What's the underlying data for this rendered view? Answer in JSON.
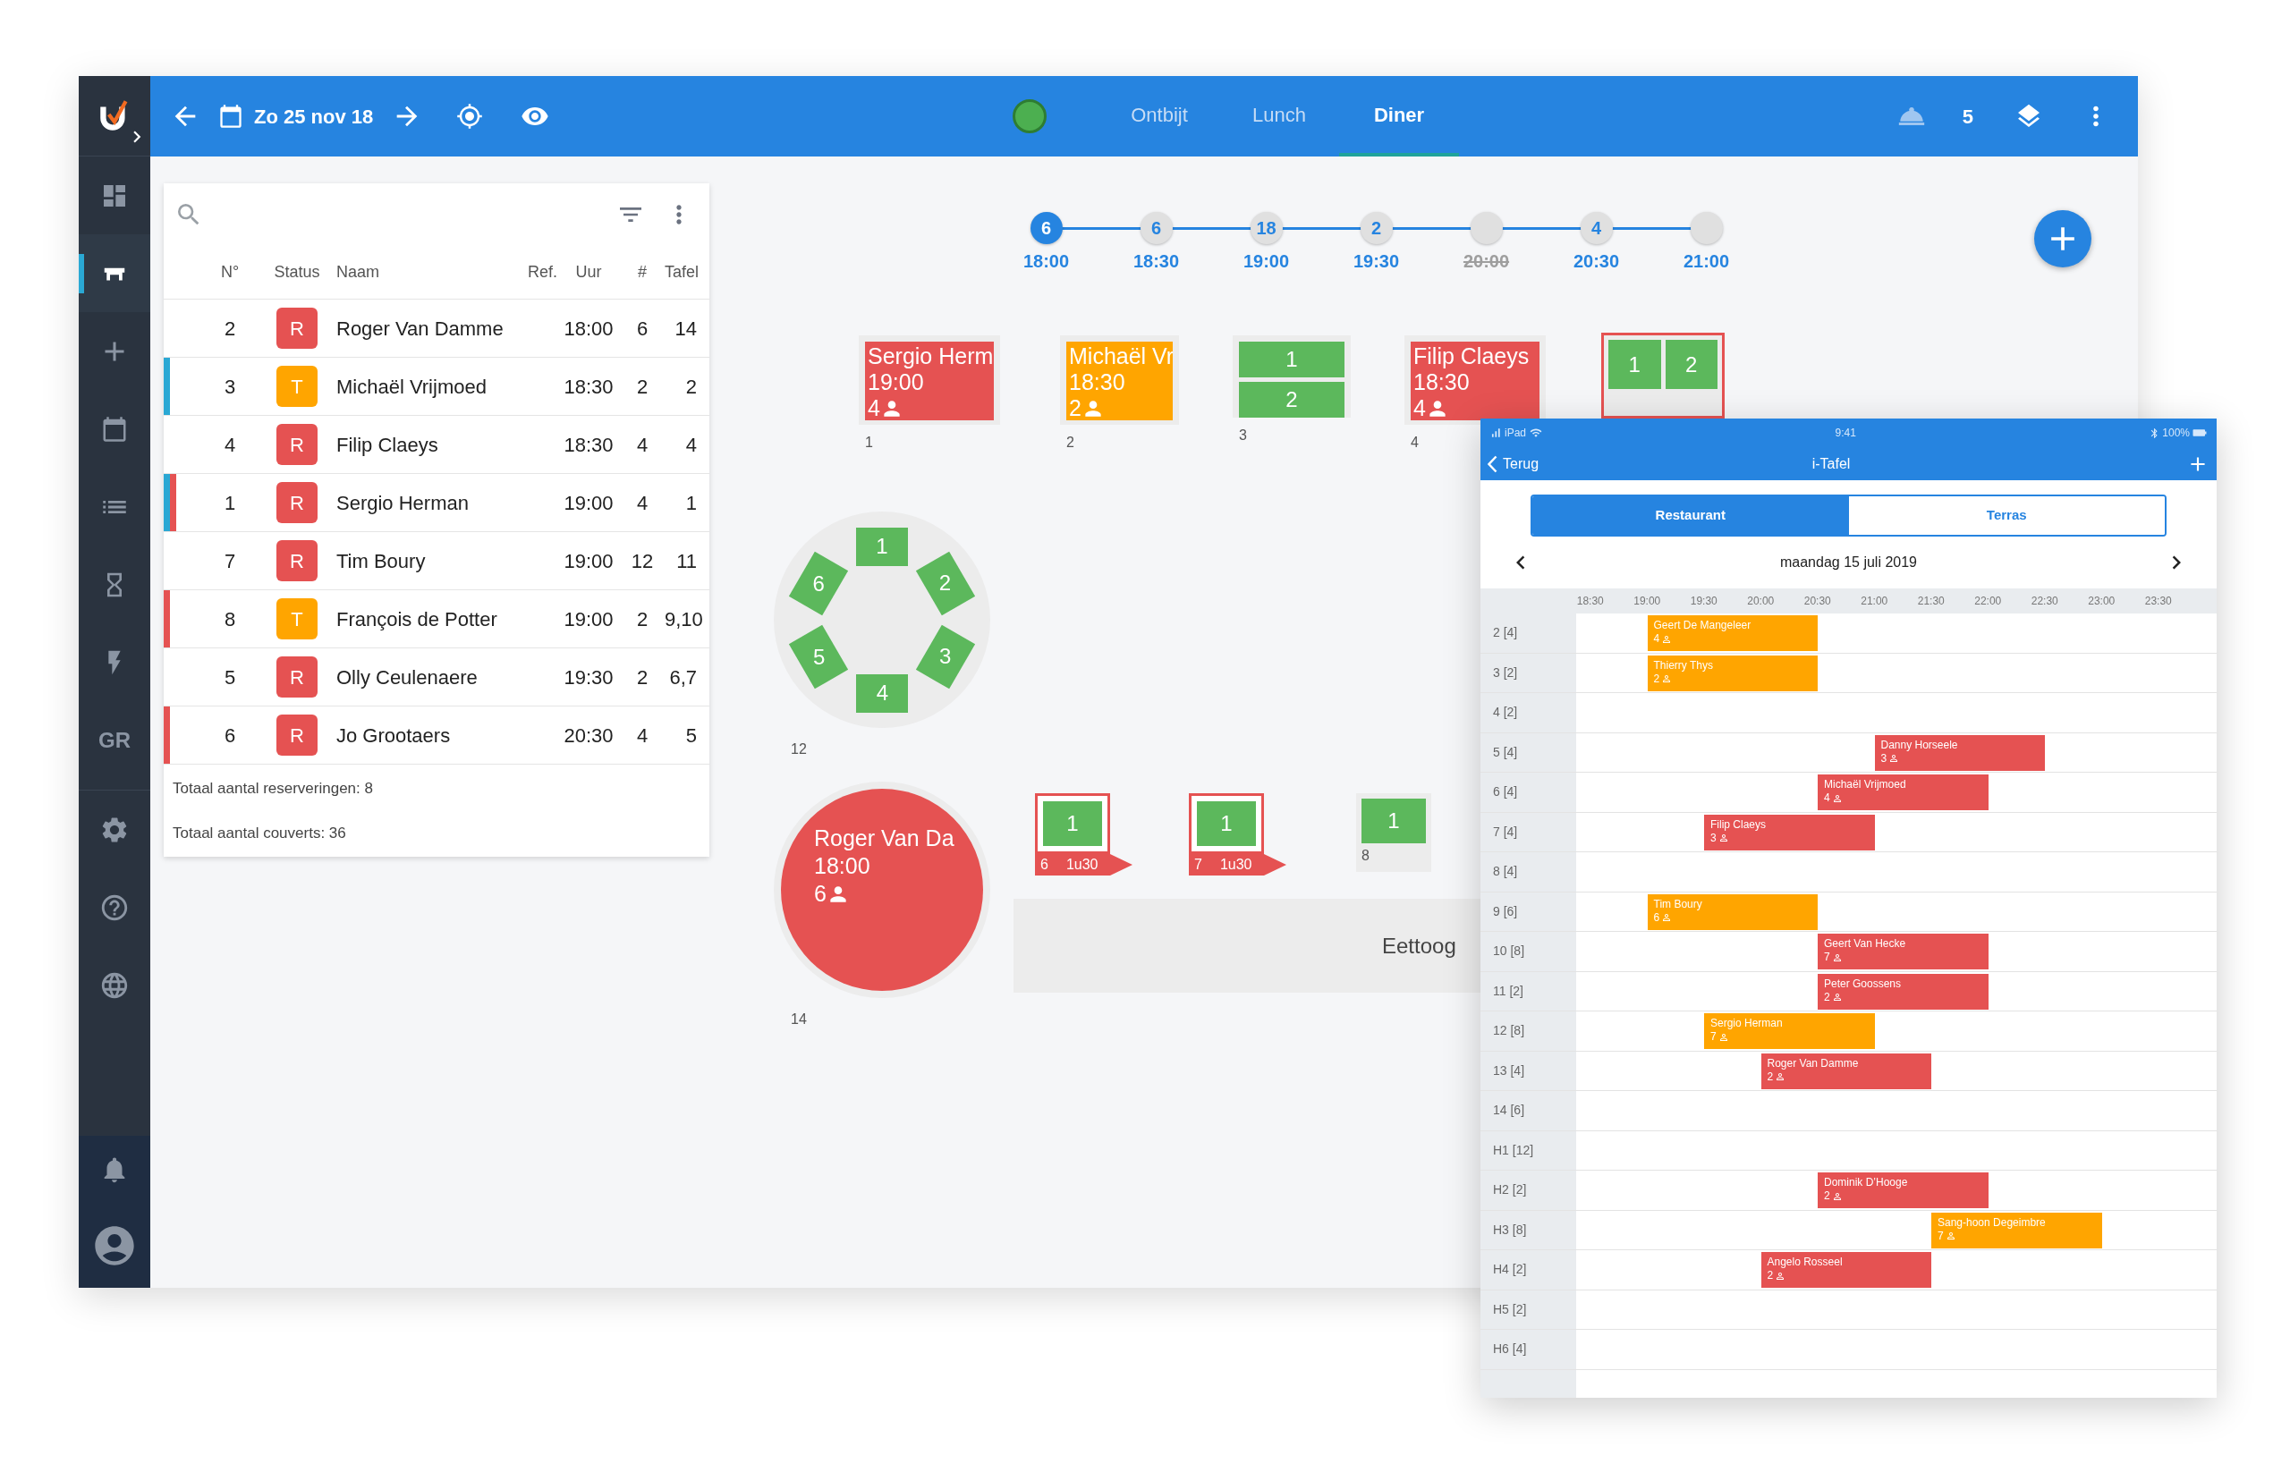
{
  "sidebar": {
    "items": [
      {
        "kind": "icon",
        "selected": false
      },
      {
        "kind": "icon",
        "selected": true
      },
      {
        "kind": "icon",
        "selected": false
      },
      {
        "kind": "icon",
        "selected": false
      },
      {
        "kind": "icon",
        "selected": false
      },
      {
        "kind": "icon",
        "selected": false
      },
      {
        "kind": "icon",
        "selected": false
      },
      {
        "kind": "text",
        "label": "GR",
        "selected": false
      }
    ]
  },
  "toolbar": {
    "date": "Zo 25 nov 18",
    "tabs": [
      {
        "label": "Ontbijt",
        "selected": false
      },
      {
        "label": "Lunch",
        "selected": false
      },
      {
        "label": "Diner",
        "selected": true
      }
    ],
    "count": "5"
  },
  "reservations": {
    "columns": [
      "N°",
      "Status",
      "Naam",
      "Ref.",
      "Uur",
      "#",
      "Tafel"
    ],
    "rows": [
      {
        "number": "2",
        "status": "R",
        "color": "#e55252",
        "name": "Roger Van Damme",
        "time": "18:00",
        "covers": "6",
        "table": "14",
        "markers": []
      },
      {
        "number": "3",
        "status": "T",
        "color": "#ffa500",
        "name": "Michaël Vrijmoed",
        "time": "18:30",
        "covers": "2",
        "table": "2",
        "markers": [
          {
            "color": "#2aa8d4"
          }
        ]
      },
      {
        "number": "4",
        "status": "R",
        "color": "#e55252",
        "name": "Filip Claeys",
        "time": "18:30",
        "covers": "4",
        "table": "4",
        "markers": []
      },
      {
        "number": "1",
        "status": "R",
        "color": "#e55252",
        "name": "Sergio Herman",
        "time": "19:00",
        "covers": "4",
        "table": "1",
        "markers": [
          {
            "color": "#2aa8d4"
          },
          {
            "color": "#e55252"
          }
        ]
      },
      {
        "number": "7",
        "status": "R",
        "color": "#e55252",
        "name": "Tim Boury",
        "time": "19:00",
        "covers": "12",
        "table": "11",
        "markers": []
      },
      {
        "number": "8",
        "status": "T",
        "color": "#ffa500",
        "name": "François de Potter",
        "time": "19:00",
        "covers": "2",
        "table": "9,10",
        "markers": [
          {
            "color": "#e55252"
          }
        ]
      },
      {
        "number": "5",
        "status": "R",
        "color": "#e55252",
        "name": "Olly Ceulenaere",
        "time": "19:30",
        "covers": "2",
        "table": "6,7",
        "markers": []
      },
      {
        "number": "6",
        "status": "R",
        "color": "#e55252",
        "name": "Jo Grootaers",
        "time": "20:30",
        "covers": "4",
        "table": "5",
        "markers": [
          {
            "color": "#e55252"
          }
        ]
      }
    ],
    "totals": [
      "Totaal aantal reserveringen: 8",
      "Totaal aantal couverts: 36"
    ]
  },
  "timeline": [
    {
      "count": "6",
      "time": "18:00",
      "selected": true,
      "disabled": false
    },
    {
      "count": "6",
      "time": "18:30",
      "selected": false,
      "disabled": false
    },
    {
      "count": "18",
      "time": "19:00",
      "selected": false,
      "disabled": false
    },
    {
      "count": "2",
      "time": "19:30",
      "selected": false,
      "disabled": false
    },
    {
      "time": "20:00",
      "selected": false,
      "disabled": true
    },
    {
      "count": "4",
      "time": "20:30",
      "selected": false,
      "disabled": false
    },
    {
      "time": "21:00",
      "selected": false,
      "disabled": false
    }
  ],
  "floor": {
    "tables": [
      {
        "kind": "booked",
        "name": "Sergio Herm",
        "time": "19:00",
        "guests": "4",
        "color": "#e55252",
        "number": "1",
        "alert": false
      },
      {
        "kind": "booked",
        "name": "Michaël Vr",
        "time": "18:30",
        "guests": "2",
        "color": "#ffa500",
        "number": "2",
        "alert": false
      },
      {
        "kind": "split",
        "seats": [
          "1",
          "2"
        ],
        "number": "3",
        "alert": false
      },
      {
        "kind": "booked",
        "name": "Filip Claeys",
        "time": "18:30",
        "guests": "4",
        "color": "#e55252",
        "number": "4",
        "alert": false
      },
      {
        "kind": "grid",
        "seats": [
          "1",
          "2"
        ],
        "alert": true
      },
      {
        "kind": "hex",
        "seats": [
          "1",
          "2",
          "3",
          "4",
          "5",
          "6"
        ],
        "number": "12",
        "alert": false
      },
      {
        "kind": "round",
        "name": "Roger Van Da",
        "time": "18:00",
        "guests": "6",
        "color": "#e55252",
        "number": "14",
        "alert": false
      },
      {
        "kind": "small",
        "seats": [
          "1"
        ],
        "tag": {
          "number": "6",
          "duration": "1u30"
        },
        "alert": true
      },
      {
        "kind": "small",
        "seats": [
          "1"
        ],
        "tag": {
          "number": "7",
          "duration": "1u30"
        },
        "alert": true
      },
      {
        "kind": "small",
        "seats": [
          "1"
        ],
        "number": "8",
        "alert": false
      }
    ],
    "zone": "Eettoog"
  },
  "tablet": {
    "status": {
      "carrier": "iPad",
      "time": "9:41",
      "battery": "100%"
    },
    "nav": {
      "back": "Terug",
      "title": "i-Tafel"
    },
    "segments": [
      {
        "label": "Restaurant",
        "selected": true
      },
      {
        "label": "Terras",
        "selected": false
      }
    ],
    "date": "maandag 15 juli 2019",
    "times": [
      "18:30",
      "19:00",
      "19:30",
      "20:00",
      "20:30",
      "21:00",
      "21:30",
      "22:00",
      "22:30",
      "23:00",
      "23:30"
    ],
    "rows": [
      {
        "label": "2 [4]",
        "bookings": [
          {
            "name": "Geert De Mangeleer",
            "guests": "4",
            "color": "#ffa500"
          }
        ]
      },
      {
        "label": "3 [2]",
        "bookings": [
          {
            "name": "Thierry Thys",
            "guests": "2",
            "color": "#ffa500"
          }
        ]
      },
      {
        "label": "4 [2]",
        "bookings": []
      },
      {
        "label": "5 [4]",
        "bookings": [
          {
            "name": "Danny Horseele",
            "guests": "3",
            "color": "#e55252"
          }
        ]
      },
      {
        "label": "6 [4]",
        "bookings": [
          {
            "name": "Michaël Vrijmoed",
            "guests": "4",
            "color": "#e55252"
          }
        ]
      },
      {
        "label": "7 [4]",
        "bookings": [
          {
            "name": "Filip Claeys",
            "guests": "3",
            "color": "#e55252"
          }
        ]
      },
      {
        "label": "8 [4]",
        "bookings": []
      },
      {
        "label": "9 [6]",
        "bookings": [
          {
            "name": "Tim Boury",
            "guests": "6",
            "color": "#ffa500"
          }
        ]
      },
      {
        "label": "10 [8]",
        "bookings": [
          {
            "name": "Geert Van Hecke",
            "guests": "7",
            "color": "#e55252"
          }
        ]
      },
      {
        "label": "11 [2]",
        "bookings": [
          {
            "name": "Peter Goossens",
            "guests": "2",
            "color": "#e55252"
          }
        ]
      },
      {
        "label": "12 [8]",
        "bookings": [
          {
            "name": "Sergio Herman",
            "guests": "7",
            "color": "#ffa500"
          }
        ]
      },
      {
        "label": "13 [4]",
        "bookings": [
          {
            "name": "Roger Van Damme",
            "guests": "2",
            "color": "#e55252"
          }
        ]
      },
      {
        "label": "14 [6]",
        "bookings": []
      },
      {
        "label": "H1 [12]",
        "bookings": []
      },
      {
        "label": "H2 [2]",
        "bookings": [
          {
            "name": "Dominik D’Hooge",
            "guests": "2",
            "color": "#e55252"
          }
        ]
      },
      {
        "label": "H3 [8]",
        "bookings": [
          {
            "name": "Sang-hoon Degeimbre",
            "guests": "7",
            "color": "#ffa500"
          }
        ]
      },
      {
        "label": "H4 [2]",
        "bookings": [
          {
            "name": "Angelo Rosseel",
            "guests": "2",
            "color": "#e55252"
          }
        ]
      },
      {
        "label": "H5 [2]",
        "bookings": []
      },
      {
        "label": "H6 [4]",
        "bookings": []
      }
    ]
  }
}
